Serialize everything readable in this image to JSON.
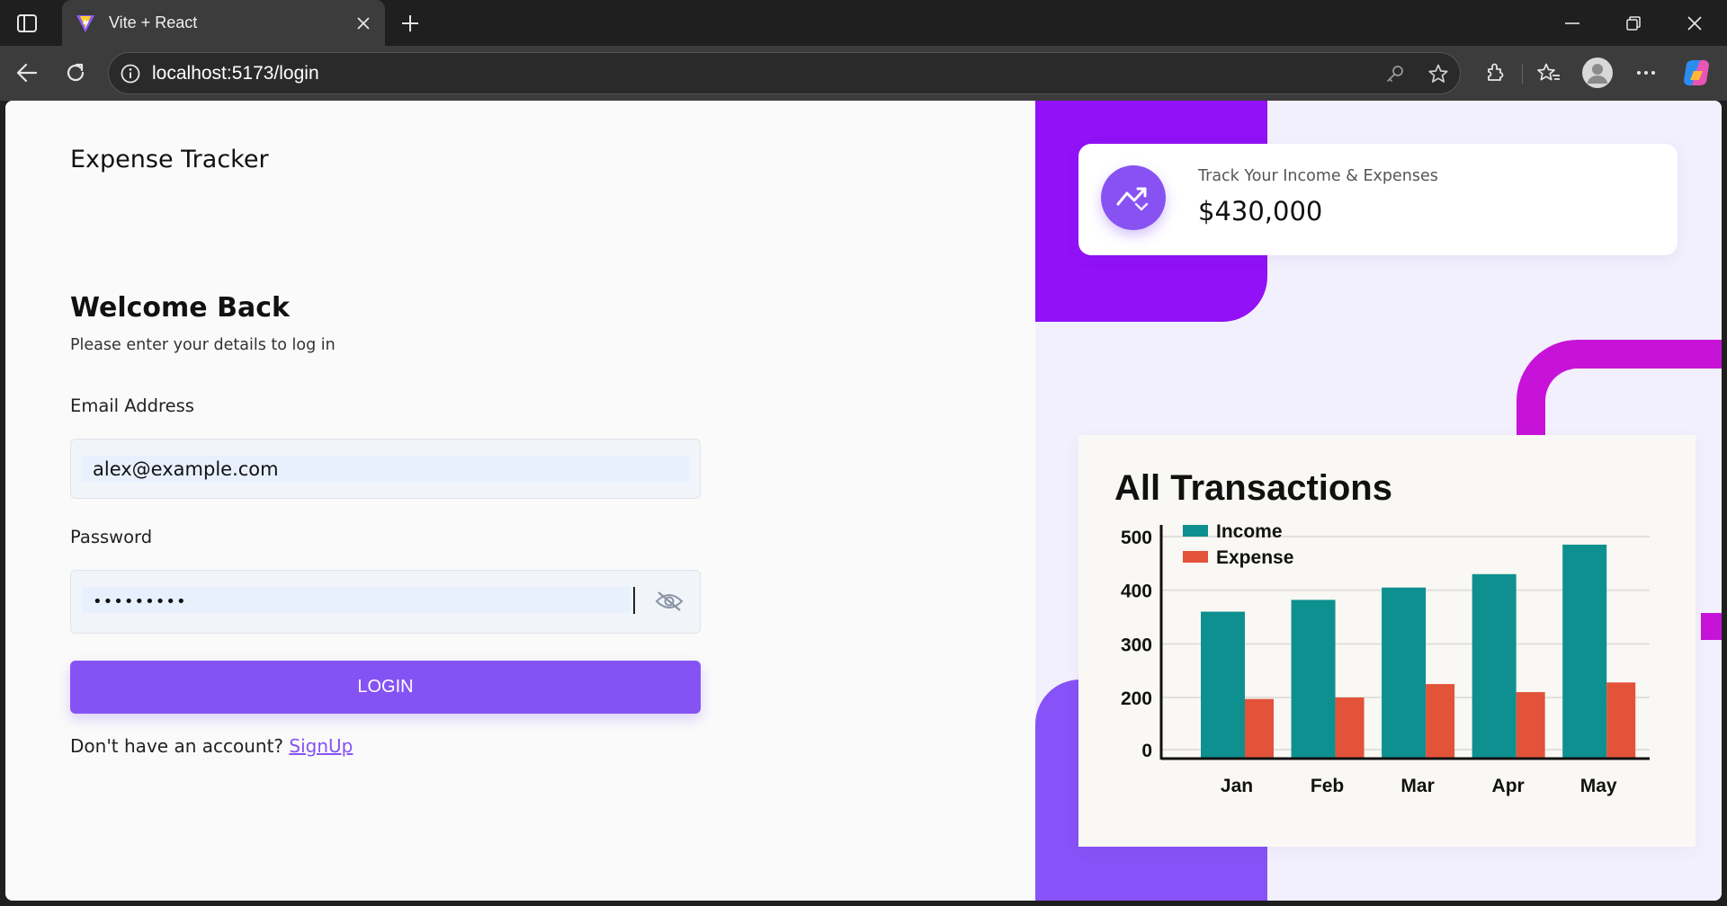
{
  "browser": {
    "tab_title": "Vite + React",
    "url": "localhost:5173/login"
  },
  "login": {
    "app_title": "Expense Tracker",
    "heading": "Welcome Back",
    "subtitle": "Please enter your details to log in",
    "email_label": "Email Address",
    "email_value": "alex@example.com",
    "password_label": "Password",
    "password_value": "•••••••••",
    "login_button": "LOGIN",
    "signup_prompt": "Don't have an account?",
    "signup_link": "SignUp"
  },
  "stat_card": {
    "label": "Track Your Income & Expenses",
    "value": "$430,000",
    "icon": "trending-up-icon"
  },
  "colors": {
    "accent": "#8553f4",
    "income": "#0e9090",
    "expense": "#e2533a"
  },
  "chart_data": {
    "type": "bar",
    "title": "All Transactions",
    "categories": [
      "Jan",
      "Feb",
      "Mar",
      "Apr",
      "May"
    ],
    "series": [
      {
        "name": "Income",
        "values": [
          360,
          382,
          405,
          430,
          485
        ],
        "color": "#0e9090"
      },
      {
        "name": "Expense",
        "values": [
          195,
          200,
          225,
          210,
          228
        ],
        "color": "#e2533a"
      }
    ],
    "yticks": [
      0,
      200,
      300,
      400,
      500
    ],
    "legend": "top-left",
    "grid": true
  }
}
